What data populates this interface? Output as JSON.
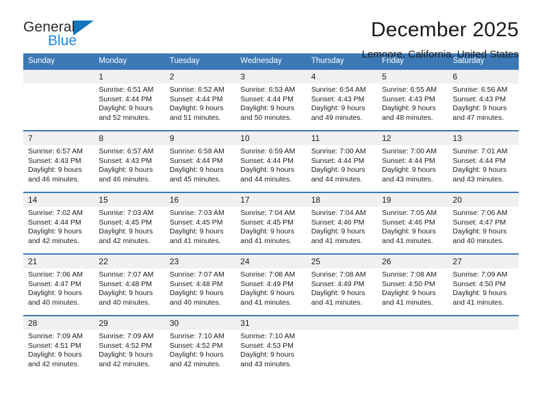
{
  "brand": {
    "line1": "General",
    "line2": "Blue",
    "triangle_color": "#1277bd",
    "blue_color": "#1c87d8"
  },
  "header": {
    "title": "December 2025",
    "subtitle": "Lemoore, California, United States"
  },
  "theme": {
    "header_blue": "#3b78b5",
    "daynum_bg": "#f0f0f0"
  },
  "weekdays": [
    "Sunday",
    "Monday",
    "Tuesday",
    "Wednesday",
    "Thursday",
    "Friday",
    "Saturday"
  ],
  "labels": {
    "sunrise_prefix": "Sunrise: ",
    "sunset_prefix": "Sunset: ",
    "daylight_prefix": "Daylight: "
  },
  "weeks": [
    [
      {
        "day": "",
        "sunrise": "",
        "sunset": "",
        "daylight_line1": "",
        "daylight_line2": ""
      },
      {
        "day": "1",
        "sunrise": "Sunrise: 6:51 AM",
        "sunset": "Sunset: 4:44 PM",
        "daylight_line1": "Daylight: 9 hours",
        "daylight_line2": "and 52 minutes."
      },
      {
        "day": "2",
        "sunrise": "Sunrise: 6:52 AM",
        "sunset": "Sunset: 4:44 PM",
        "daylight_line1": "Daylight: 9 hours",
        "daylight_line2": "and 51 minutes."
      },
      {
        "day": "3",
        "sunrise": "Sunrise: 6:53 AM",
        "sunset": "Sunset: 4:44 PM",
        "daylight_line1": "Daylight: 9 hours",
        "daylight_line2": "and 50 minutes."
      },
      {
        "day": "4",
        "sunrise": "Sunrise: 6:54 AM",
        "sunset": "Sunset: 4:43 PM",
        "daylight_line1": "Daylight: 9 hours",
        "daylight_line2": "and 49 minutes."
      },
      {
        "day": "5",
        "sunrise": "Sunrise: 6:55 AM",
        "sunset": "Sunset: 4:43 PM",
        "daylight_line1": "Daylight: 9 hours",
        "daylight_line2": "and 48 minutes."
      },
      {
        "day": "6",
        "sunrise": "Sunrise: 6:56 AM",
        "sunset": "Sunset: 4:43 PM",
        "daylight_line1": "Daylight: 9 hours",
        "daylight_line2": "and 47 minutes."
      }
    ],
    [
      {
        "day": "7",
        "sunrise": "Sunrise: 6:57 AM",
        "sunset": "Sunset: 4:43 PM",
        "daylight_line1": "Daylight: 9 hours",
        "daylight_line2": "and 46 minutes."
      },
      {
        "day": "8",
        "sunrise": "Sunrise: 6:57 AM",
        "sunset": "Sunset: 4:43 PM",
        "daylight_line1": "Daylight: 9 hours",
        "daylight_line2": "and 46 minutes."
      },
      {
        "day": "9",
        "sunrise": "Sunrise: 6:58 AM",
        "sunset": "Sunset: 4:44 PM",
        "daylight_line1": "Daylight: 9 hours",
        "daylight_line2": "and 45 minutes."
      },
      {
        "day": "10",
        "sunrise": "Sunrise: 6:59 AM",
        "sunset": "Sunset: 4:44 PM",
        "daylight_line1": "Daylight: 9 hours",
        "daylight_line2": "and 44 minutes."
      },
      {
        "day": "11",
        "sunrise": "Sunrise: 7:00 AM",
        "sunset": "Sunset: 4:44 PM",
        "daylight_line1": "Daylight: 9 hours",
        "daylight_line2": "and 44 minutes."
      },
      {
        "day": "12",
        "sunrise": "Sunrise: 7:00 AM",
        "sunset": "Sunset: 4:44 PM",
        "daylight_line1": "Daylight: 9 hours",
        "daylight_line2": "and 43 minutes."
      },
      {
        "day": "13",
        "sunrise": "Sunrise: 7:01 AM",
        "sunset": "Sunset: 4:44 PM",
        "daylight_line1": "Daylight: 9 hours",
        "daylight_line2": "and 43 minutes."
      }
    ],
    [
      {
        "day": "14",
        "sunrise": "Sunrise: 7:02 AM",
        "sunset": "Sunset: 4:44 PM",
        "daylight_line1": "Daylight: 9 hours",
        "daylight_line2": "and 42 minutes."
      },
      {
        "day": "15",
        "sunrise": "Sunrise: 7:03 AM",
        "sunset": "Sunset: 4:45 PM",
        "daylight_line1": "Daylight: 9 hours",
        "daylight_line2": "and 42 minutes."
      },
      {
        "day": "16",
        "sunrise": "Sunrise: 7:03 AM",
        "sunset": "Sunset: 4:45 PM",
        "daylight_line1": "Daylight: 9 hours",
        "daylight_line2": "and 41 minutes."
      },
      {
        "day": "17",
        "sunrise": "Sunrise: 7:04 AM",
        "sunset": "Sunset: 4:45 PM",
        "daylight_line1": "Daylight: 9 hours",
        "daylight_line2": "and 41 minutes."
      },
      {
        "day": "18",
        "sunrise": "Sunrise: 7:04 AM",
        "sunset": "Sunset: 4:46 PM",
        "daylight_line1": "Daylight: 9 hours",
        "daylight_line2": "and 41 minutes."
      },
      {
        "day": "19",
        "sunrise": "Sunrise: 7:05 AM",
        "sunset": "Sunset: 4:46 PM",
        "daylight_line1": "Daylight: 9 hours",
        "daylight_line2": "and 41 minutes."
      },
      {
        "day": "20",
        "sunrise": "Sunrise: 7:06 AM",
        "sunset": "Sunset: 4:47 PM",
        "daylight_line1": "Daylight: 9 hours",
        "daylight_line2": "and 40 minutes."
      }
    ],
    [
      {
        "day": "21",
        "sunrise": "Sunrise: 7:06 AM",
        "sunset": "Sunset: 4:47 PM",
        "daylight_line1": "Daylight: 9 hours",
        "daylight_line2": "and 40 minutes."
      },
      {
        "day": "22",
        "sunrise": "Sunrise: 7:07 AM",
        "sunset": "Sunset: 4:48 PM",
        "daylight_line1": "Daylight: 9 hours",
        "daylight_line2": "and 40 minutes."
      },
      {
        "day": "23",
        "sunrise": "Sunrise: 7:07 AM",
        "sunset": "Sunset: 4:48 PM",
        "daylight_line1": "Daylight: 9 hours",
        "daylight_line2": "and 40 minutes."
      },
      {
        "day": "24",
        "sunrise": "Sunrise: 7:08 AM",
        "sunset": "Sunset: 4:49 PM",
        "daylight_line1": "Daylight: 9 hours",
        "daylight_line2": "and 41 minutes."
      },
      {
        "day": "25",
        "sunrise": "Sunrise: 7:08 AM",
        "sunset": "Sunset: 4:49 PM",
        "daylight_line1": "Daylight: 9 hours",
        "daylight_line2": "and 41 minutes."
      },
      {
        "day": "26",
        "sunrise": "Sunrise: 7:08 AM",
        "sunset": "Sunset: 4:50 PM",
        "daylight_line1": "Daylight: 9 hours",
        "daylight_line2": "and 41 minutes."
      },
      {
        "day": "27",
        "sunrise": "Sunrise: 7:09 AM",
        "sunset": "Sunset: 4:50 PM",
        "daylight_line1": "Daylight: 9 hours",
        "daylight_line2": "and 41 minutes."
      }
    ],
    [
      {
        "day": "28",
        "sunrise": "Sunrise: 7:09 AM",
        "sunset": "Sunset: 4:51 PM",
        "daylight_line1": "Daylight: 9 hours",
        "daylight_line2": "and 42 minutes."
      },
      {
        "day": "29",
        "sunrise": "Sunrise: 7:09 AM",
        "sunset": "Sunset: 4:52 PM",
        "daylight_line1": "Daylight: 9 hours",
        "daylight_line2": "and 42 minutes."
      },
      {
        "day": "30",
        "sunrise": "Sunrise: 7:10 AM",
        "sunset": "Sunset: 4:52 PM",
        "daylight_line1": "Daylight: 9 hours",
        "daylight_line2": "and 42 minutes."
      },
      {
        "day": "31",
        "sunrise": "Sunrise: 7:10 AM",
        "sunset": "Sunset: 4:53 PM",
        "daylight_line1": "Daylight: 9 hours",
        "daylight_line2": "and 43 minutes."
      },
      {
        "day": "",
        "sunrise": "",
        "sunset": "",
        "daylight_line1": "",
        "daylight_line2": ""
      },
      {
        "day": "",
        "sunrise": "",
        "sunset": "",
        "daylight_line1": "",
        "daylight_line2": ""
      },
      {
        "day": "",
        "sunrise": "",
        "sunset": "",
        "daylight_line1": "",
        "daylight_line2": ""
      }
    ]
  ]
}
